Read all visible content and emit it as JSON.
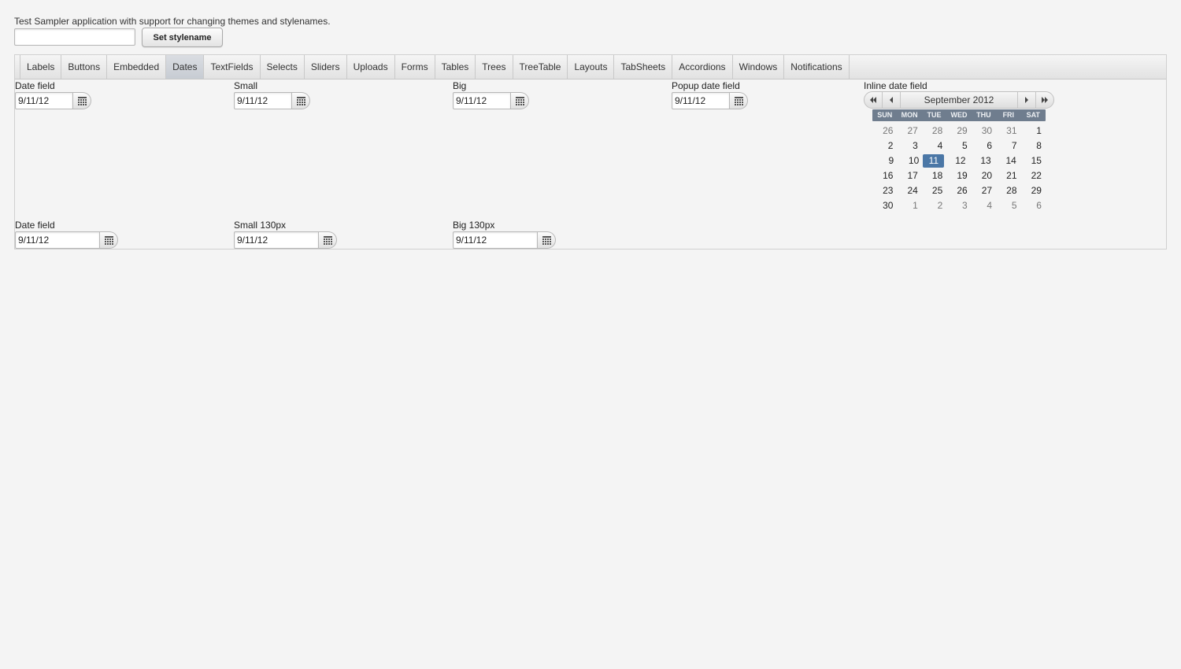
{
  "intro_text": "Test Sampler application with support for changing themes and stylenames.",
  "stylename": {
    "value": "",
    "button_label": "Set stylename"
  },
  "tabs": [
    {
      "label": "Labels"
    },
    {
      "label": "Buttons"
    },
    {
      "label": "Embedded"
    },
    {
      "label": "Dates",
      "selected": true
    },
    {
      "label": "TextFields"
    },
    {
      "label": "Selects"
    },
    {
      "label": "Sliders"
    },
    {
      "label": "Uploads"
    },
    {
      "label": "Forms"
    },
    {
      "label": "Tables"
    },
    {
      "label": "Trees"
    },
    {
      "label": "TreeTable"
    },
    {
      "label": "Layouts"
    },
    {
      "label": "TabSheets"
    },
    {
      "label": "Accordions"
    },
    {
      "label": "Windows"
    },
    {
      "label": "Notifications"
    }
  ],
  "fields": {
    "date_field": {
      "caption": "Date field",
      "value": "9/11/12"
    },
    "small": {
      "caption": "Small",
      "value": "9/11/12"
    },
    "big": {
      "caption": "Big",
      "value": "9/11/12"
    },
    "popup": {
      "caption": "Popup date field",
      "value": "9/11/12"
    },
    "date_field_2": {
      "caption": "Date field",
      "value": "9/11/12"
    },
    "small_130": {
      "caption": "Small 130px",
      "value": "9/11/12"
    },
    "big_130": {
      "caption": "Big 130px",
      "value": "9/11/12"
    }
  },
  "inline_calendar": {
    "caption": "Inline date field",
    "month_label": "September 2012",
    "weekdays": [
      "SUN",
      "MON",
      "TUE",
      "WED",
      "THU",
      "FRI",
      "SAT"
    ],
    "weeks": [
      [
        "26",
        "27",
        "28",
        "29",
        "30",
        "31",
        "1"
      ],
      [
        "2",
        "3",
        "4",
        "5",
        "6",
        "7",
        "8"
      ],
      [
        "9",
        "10",
        "11",
        "12",
        "13",
        "14",
        "15"
      ],
      [
        "16",
        "17",
        "18",
        "19",
        "20",
        "21",
        "22"
      ],
      [
        "23",
        "24",
        "25",
        "26",
        "27",
        "28",
        "29"
      ],
      [
        "30",
        "1",
        "2",
        "3",
        "4",
        "5",
        "6"
      ]
    ],
    "selected_day": "11",
    "colors": {
      "header_bg": "#6f7d8e",
      "selected_bg": "#4b77a6"
    }
  }
}
